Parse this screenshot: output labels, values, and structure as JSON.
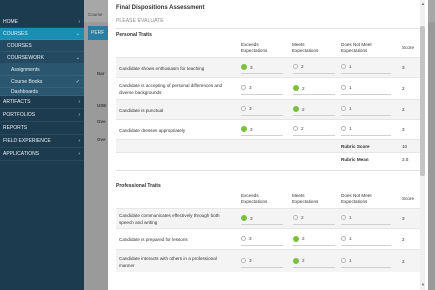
{
  "sidebar": {
    "items": [
      {
        "label": "HOME",
        "kind": "top",
        "arrow": "›"
      },
      {
        "label": "COURSES",
        "kind": "active",
        "arrow": "⌄"
      },
      {
        "label": "COURSES",
        "kind": "sub",
        "arrow": ""
      },
      {
        "label": "COURSEWORK",
        "kind": "sub",
        "arrow": "⌄"
      },
      {
        "label": "Assignments",
        "kind": "sub2",
        "arrow": ""
      },
      {
        "label": "Course Books",
        "kind": "sub2",
        "arrow": "✓"
      },
      {
        "label": "Dashboards",
        "kind": "sub2",
        "arrow": ""
      },
      {
        "label": "ARTIFACTS",
        "kind": "top",
        "arrow": "›"
      },
      {
        "label": "PORTFOLIOS",
        "kind": "top",
        "arrow": "›"
      },
      {
        "label": "REPORTS",
        "kind": "top",
        "arrow": ""
      },
      {
        "label": "FIELD EXPERIENCE",
        "kind": "top",
        "arrow": "›"
      },
      {
        "label": "APPLICATIONS",
        "kind": "top",
        "arrow": "›"
      }
    ]
  },
  "background": {
    "breadcrumb": "Course",
    "tab": "PERF",
    "labels": [
      "Nar",
      "USE",
      "Ove",
      "Ove"
    ]
  },
  "modal": {
    "title": "Final Dispositions Assessment",
    "instruction": "PLEASE EVALUATE",
    "sections": [
      {
        "title": "Personal Traits",
        "headers": [
          "Exceeds Expectations",
          "Meets Expectations",
          "Does Not Meet Expectations",
          "Score"
        ],
        "rows": [
          {
            "criterion": "Candidate shows enthusiasm for teaching",
            "options": [
              "3",
              "2",
              "1"
            ],
            "selected": 0,
            "score": "3"
          },
          {
            "criterion": "Candidate is accepting of personal differences and diverse backgrounds",
            "options": [
              "3",
              "2",
              "1"
            ],
            "selected": 1,
            "score": "2"
          },
          {
            "criterion": "Candidate is punctual",
            "options": [
              "3",
              "2",
              "1"
            ],
            "selected": 1,
            "score": "2"
          },
          {
            "criterion": "Candidate dresses appropriately",
            "options": [
              "3",
              "2",
              "1"
            ],
            "selected": 0,
            "score": "3"
          }
        ],
        "summary": [
          {
            "label": "Rubric Score",
            "value": "10"
          },
          {
            "label": "Rubric Mean",
            "value": "2.5"
          }
        ]
      },
      {
        "title": "Professional Traits",
        "headers": [
          "Exceeds Expectations",
          "Meets Expectations",
          "Does Not Meet Expectations",
          "Score"
        ],
        "rows": [
          {
            "criterion": "Candidate communicates effectively through both speech and writing",
            "options": [
              "3",
              "2",
              "1"
            ],
            "selected": 0,
            "score": "3"
          },
          {
            "criterion": "Candidate is prepared for lessons",
            "options": [
              "3",
              "2",
              "1"
            ],
            "selected": 1,
            "score": "2"
          },
          {
            "criterion": "Candidate interacts with others in a professional manner",
            "options": [
              "3",
              "2",
              "1"
            ],
            "selected": 1,
            "score": "2"
          }
        ]
      }
    ]
  },
  "colors": {
    "sidebar": "#1d3b4f",
    "accent": "#1a8fb4",
    "selected_radio": "#79c13b"
  }
}
